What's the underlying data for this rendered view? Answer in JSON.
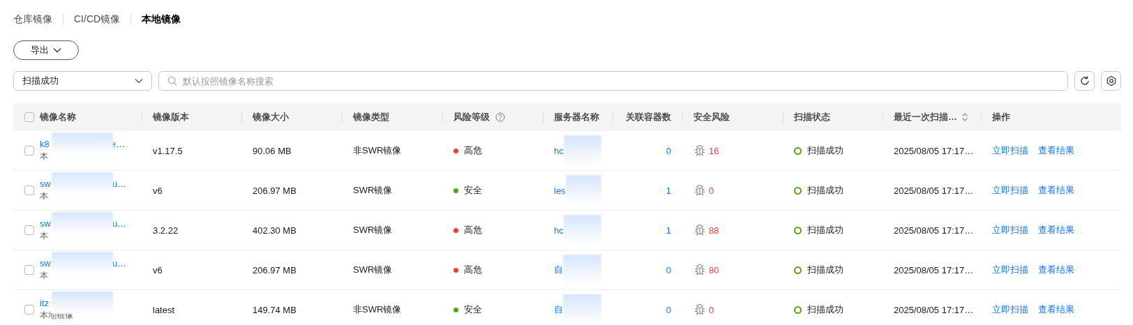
{
  "tabs": [
    {
      "label": "仓库镜像",
      "selected": false
    },
    {
      "label": "CI/CD镜像",
      "selected": false
    },
    {
      "label": "本地镜像",
      "selected": true
    }
  ],
  "export_button": {
    "label": "导出"
  },
  "status_filter": {
    "value": "扫描成功"
  },
  "search": {
    "placeholder": "默认按照镜像名称搜索"
  },
  "table": {
    "select_all_checked": false,
    "columns": [
      {
        "label": "镜像名称"
      },
      {
        "label": "镜像版本"
      },
      {
        "label": "镜像大小"
      },
      {
        "label": "镜像类型"
      },
      {
        "label": "风险等级",
        "help": true
      },
      {
        "label": "服务器名称"
      },
      {
        "label": "关联容器数"
      },
      {
        "label": "安全风险"
      },
      {
        "label": "扫描状态"
      },
      {
        "label": "最近一次扫描…",
        "sortable": true
      },
      {
        "label": "操作"
      }
    ],
    "rows": [
      {
        "checked": false,
        "name_head": "k8",
        "name_tail": "e…",
        "source": "本",
        "version": "v1.17.5",
        "size": "90.06 MB",
        "type": "非SWR镜像",
        "risk": {
          "label": "高危",
          "color": "#e8403b"
        },
        "server_head": "hc",
        "containers": "0",
        "vulns": "16",
        "scan_status": "扫描成功",
        "last_scan": "2025/08/05 17:17…",
        "actions": [
          "立即扫描",
          "查看结果"
        ]
      },
      {
        "checked": false,
        "name_head": "sw",
        "name_tail": "u…",
        "source": "本",
        "version": "v6",
        "size": "206.97 MB",
        "type": "SWR镜像",
        "risk": {
          "label": "安全",
          "color": "#52a80a"
        },
        "server_head": "les",
        "containers": "1",
        "vulns": "0",
        "scan_status": "扫描成功",
        "last_scan": "2025/08/05 17:17…",
        "actions": [
          "立即扫描",
          "查看结果"
        ]
      },
      {
        "checked": false,
        "name_head": "sw",
        "name_tail": "u…",
        "source": "本",
        "version": "3.2.22",
        "size": "402.30 MB",
        "type": "SWR镜像",
        "risk": {
          "label": "高危",
          "color": "#e8403b"
        },
        "server_head": "hc",
        "containers": "1",
        "vulns": "88",
        "scan_status": "扫描成功",
        "last_scan": "2025/08/05 17:17…",
        "actions": [
          "立即扫描",
          "查看结果"
        ]
      },
      {
        "checked": false,
        "name_head": "sw",
        "name_tail": "u…",
        "source": "本",
        "version": "v6",
        "size": "206.97 MB",
        "type": "SWR镜像",
        "risk": {
          "label": "高危",
          "color": "#e8403b"
        },
        "server_head": "自",
        "containers": "0",
        "vulns": "80",
        "scan_status": "扫描成功",
        "last_scan": "2025/08/05 17:17…",
        "actions": [
          "立即扫描",
          "查看结果"
        ]
      },
      {
        "checked": false,
        "name_head": "itz",
        "source": "本地镜像",
        "version": "latest",
        "size": "149.74 MB",
        "type": "非SWR镜像",
        "risk": {
          "label": "安全",
          "color": "#52a80a"
        },
        "server_head": "自",
        "containers": "0",
        "vulns": "0",
        "scan_status": "扫描成功",
        "last_scan": "2025/08/05 17:17…",
        "actions": [
          "立即扫描",
          "查看结果"
        ]
      }
    ]
  }
}
